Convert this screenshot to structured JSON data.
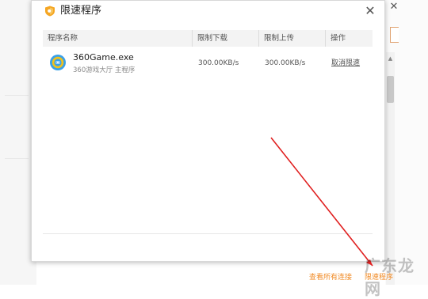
{
  "dialog": {
    "title": "限速程序",
    "close_glyph": "✕"
  },
  "table": {
    "headers": [
      "程序名称",
      "限制下载",
      "限制上传",
      "操作"
    ],
    "rows": [
      {
        "name": "360Game.exe",
        "description": "360游戏大厅 主程序",
        "download_limit": "300.00KB/s",
        "upload_limit": "300.00KB/s",
        "action": "取消限速",
        "icon": "360game-app-icon"
      }
    ]
  },
  "footer_links": {
    "view_all": "查看所有连接",
    "limit_programs": "限速程序"
  },
  "background_window": {
    "close_glyph": "✕"
  },
  "watermark": "广东龙网",
  "colors": {
    "accent_orange": "#f08a24",
    "arrow_red": "#e02020",
    "header_bg": "#f3f3f3"
  }
}
